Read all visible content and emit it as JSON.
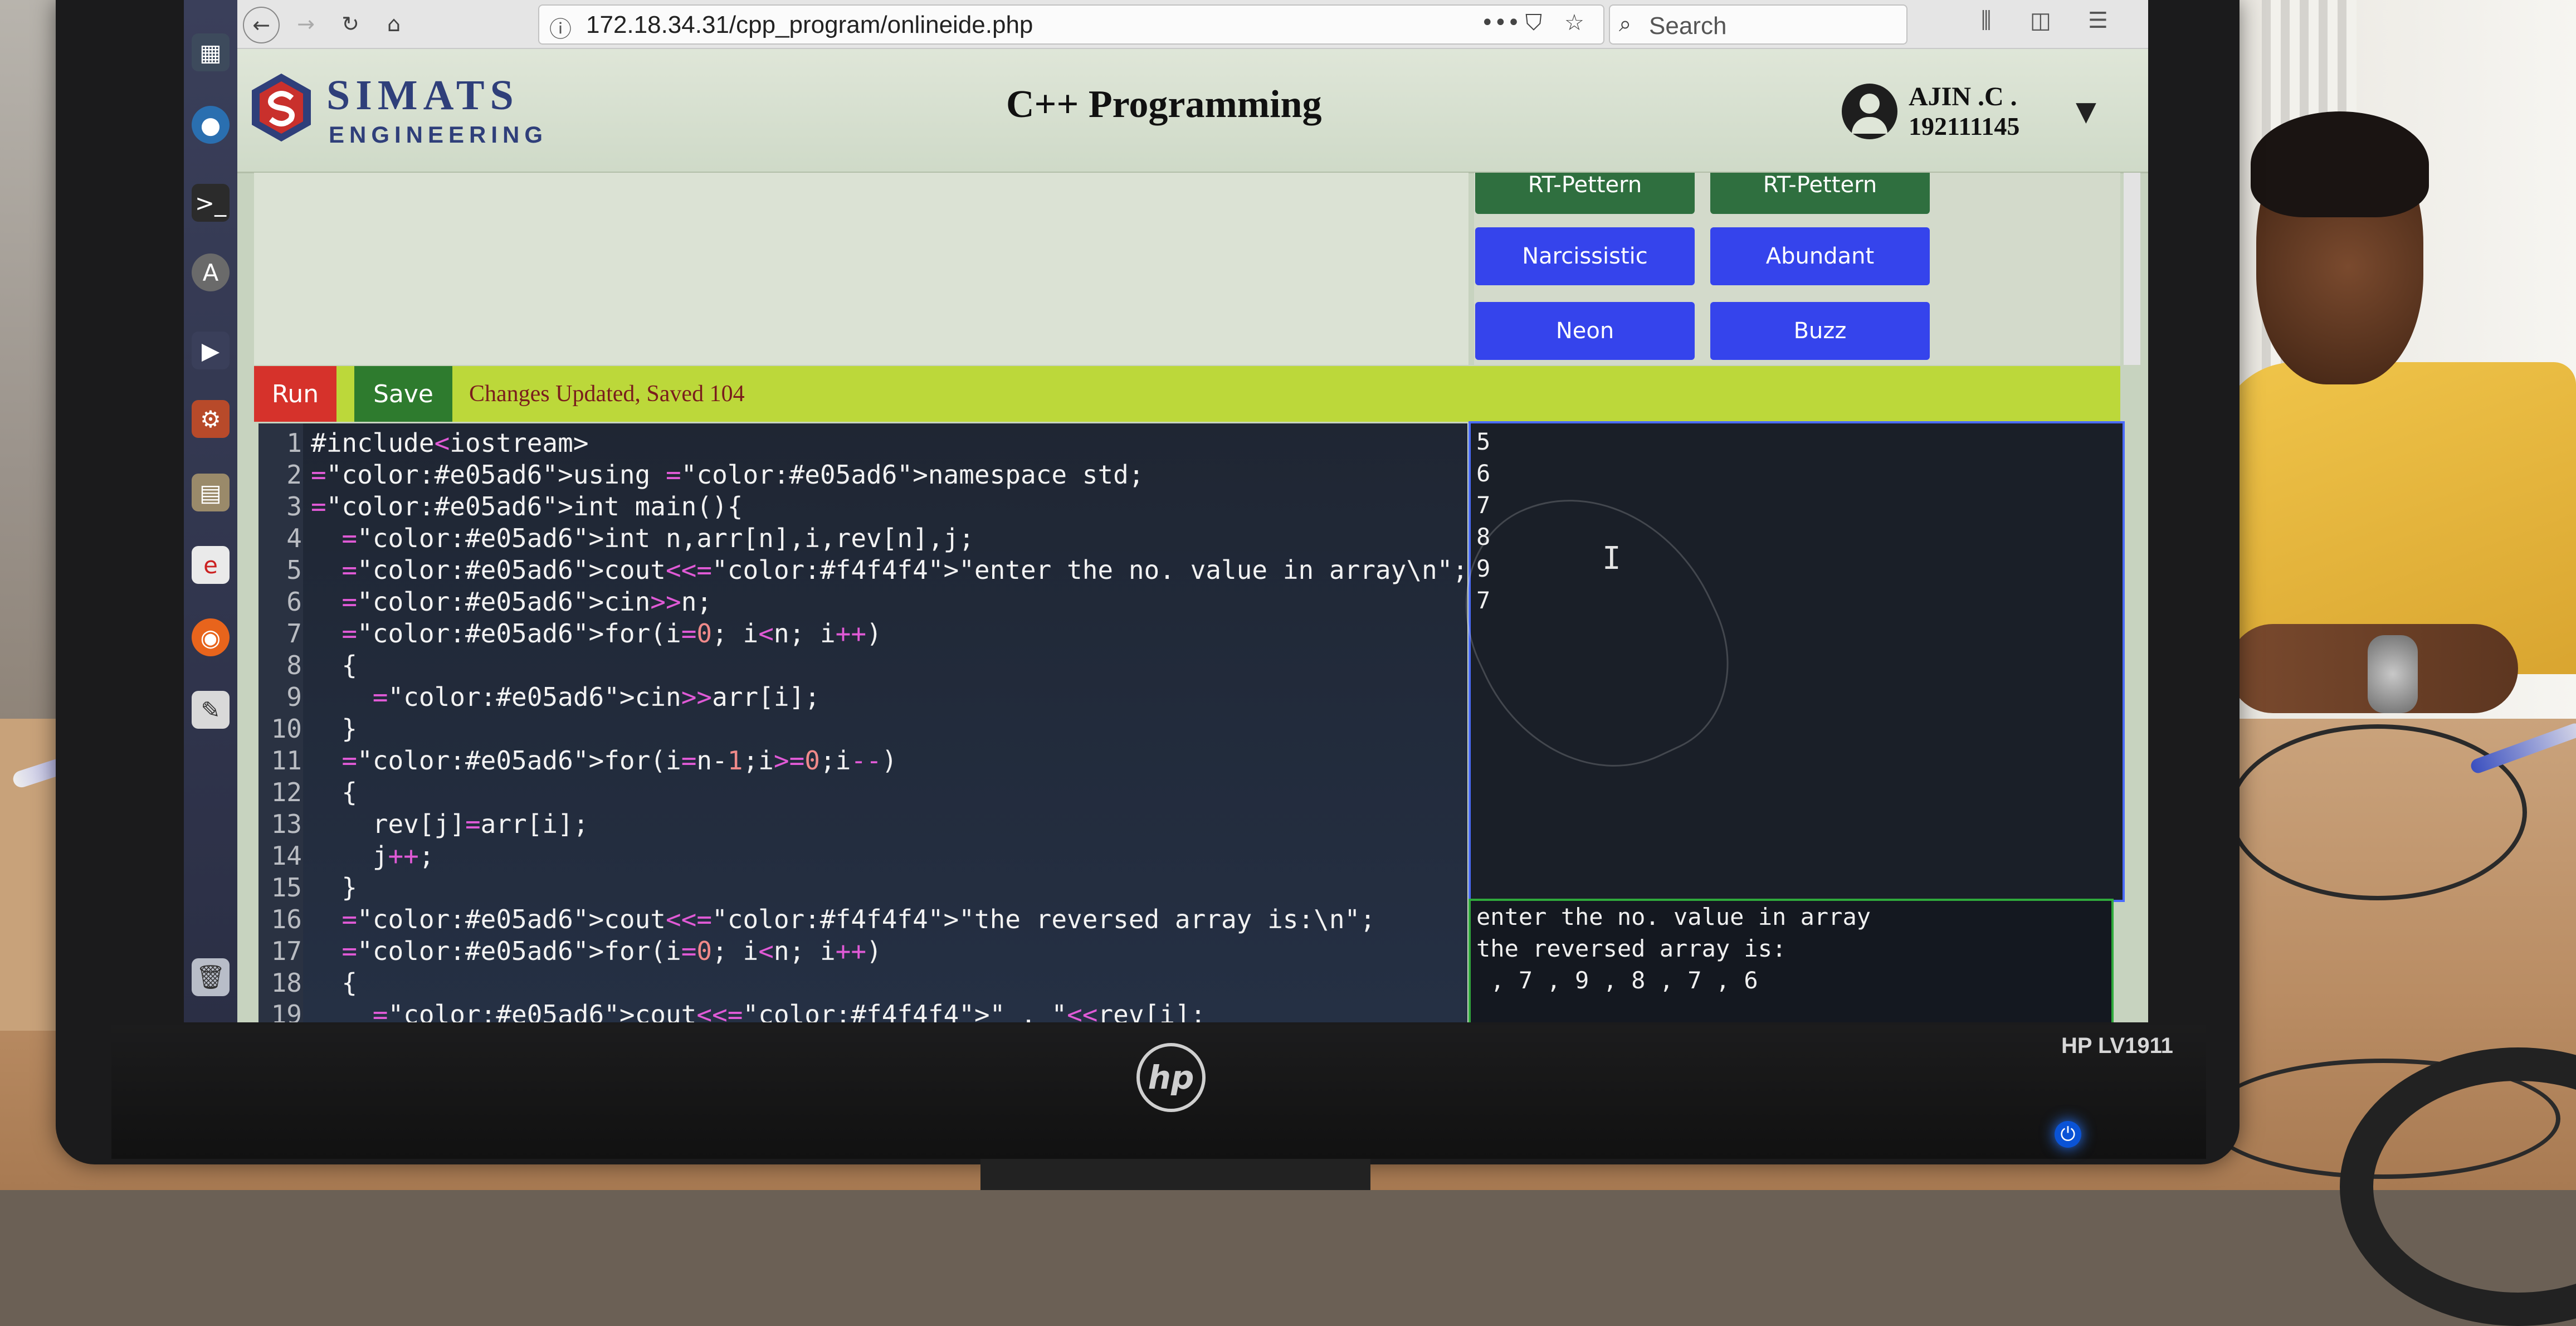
{
  "browser": {
    "url": "172.18.34.31/cpp_program/onlineide.php",
    "url_actions": [
      "•••",
      "⛉",
      "☆"
    ],
    "search_placeholder": "Search"
  },
  "header": {
    "logo_line1": "SIMATS",
    "logo_line2": "ENGINEERING",
    "title": "C++ Programming",
    "user_name": "AJIN .C .",
    "user_id": "192111145",
    "dropdown_arrow": "▼"
  },
  "programs": [
    {
      "label": "RT-Pettern",
      "color": "#2f6f3f"
    },
    {
      "label": "RT-Pettern",
      "color": "#2f6f3f"
    },
    {
      "label": "Narcissistic",
      "color": "#3544ec"
    },
    {
      "label": "Abundant",
      "color": "#3544ec"
    },
    {
      "label": "Neon",
      "color": "#3544ec"
    },
    {
      "label": "Buzz",
      "color": "#3544ec"
    }
  ],
  "actions": {
    "run_label": "Run",
    "save_label": "Save",
    "status_text": "Changes Updated, Saved 104"
  },
  "code": [
    {
      "n": "1",
      "text": "#include<iostream>"
    },
    {
      "n": "2",
      "text": "using namespace std;"
    },
    {
      "n": "3",
      "text": "int main(){"
    },
    {
      "n": "4",
      "text": "  int n,arr[n],i,rev[n],j;"
    },
    {
      "n": "5",
      "text": "  cout<<\"enter the no. value in array\\n\";"
    },
    {
      "n": "6",
      "text": "  cin>>n;"
    },
    {
      "n": "7",
      "text": "  for(i=0; i<n; i++)"
    },
    {
      "n": "8",
      "text": "  {"
    },
    {
      "n": "9",
      "text": "    cin>>arr[i];"
    },
    {
      "n": "10",
      "text": "  }"
    },
    {
      "n": "11",
      "text": "  for(i=n-1;i>=0;i--)"
    },
    {
      "n": "12",
      "text": "  {"
    },
    {
      "n": "13",
      "text": "    rev[j]=arr[i];"
    },
    {
      "n": "14",
      "text": "    j++;"
    },
    {
      "n": "15",
      "text": "  }"
    },
    {
      "n": "16",
      "text": "  cout<<\"the reversed array is:\\n\";"
    },
    {
      "n": "17",
      "text": "  for(i=0; i<n; i++)"
    },
    {
      "n": "18",
      "text": "  {"
    },
    {
      "n": "19",
      "text": "    cout<<\" , \"<<rev[i];"
    }
  ],
  "input_values": [
    "5",
    "6",
    "7",
    "8",
    "9",
    "7"
  ],
  "output_lines": [
    "enter the no. value in array",
    "the reversed array is:",
    " , 7 , 9 , 8 , 7 , 6"
  ],
  "monitor": {
    "brand": "hp",
    "model": "HP LV1911"
  },
  "colors": {
    "run": "#d6322b",
    "save": "#2e7b2e",
    "actionbar": "#bcd83a",
    "input_border": "#4a6bff",
    "output_border": "#2faa3c"
  }
}
